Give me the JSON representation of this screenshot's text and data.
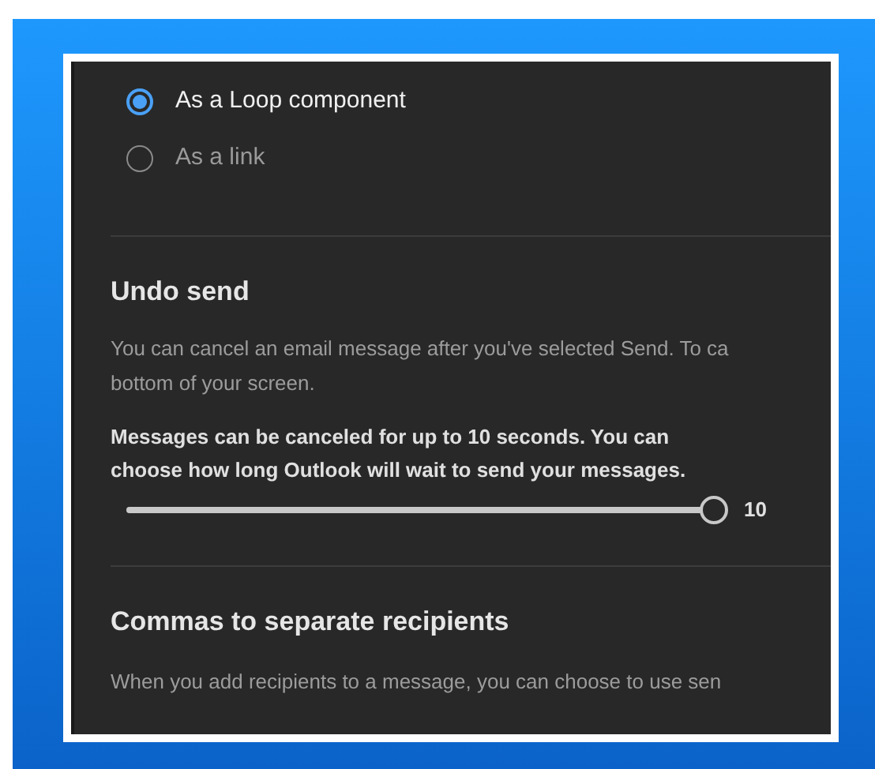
{
  "loop_options": [
    {
      "label": "As a Loop component",
      "selected": true
    },
    {
      "label": "As a link",
      "selected": false
    }
  ],
  "undo_send": {
    "title": "Undo send",
    "description_lines": [
      "You can cancel an email message after you've selected Send. To ca",
      "bottom of your screen."
    ],
    "note_lines": [
      "Messages can be canceled for up to 10 seconds. You can",
      "choose how long Outlook will wait to send your messages."
    ],
    "slider": {
      "level": 1,
      "reading": "10"
    }
  },
  "commas": {
    "title": "Commas to separate recipients",
    "description": "When you add recipients to a message, you can choose to use sen"
  }
}
